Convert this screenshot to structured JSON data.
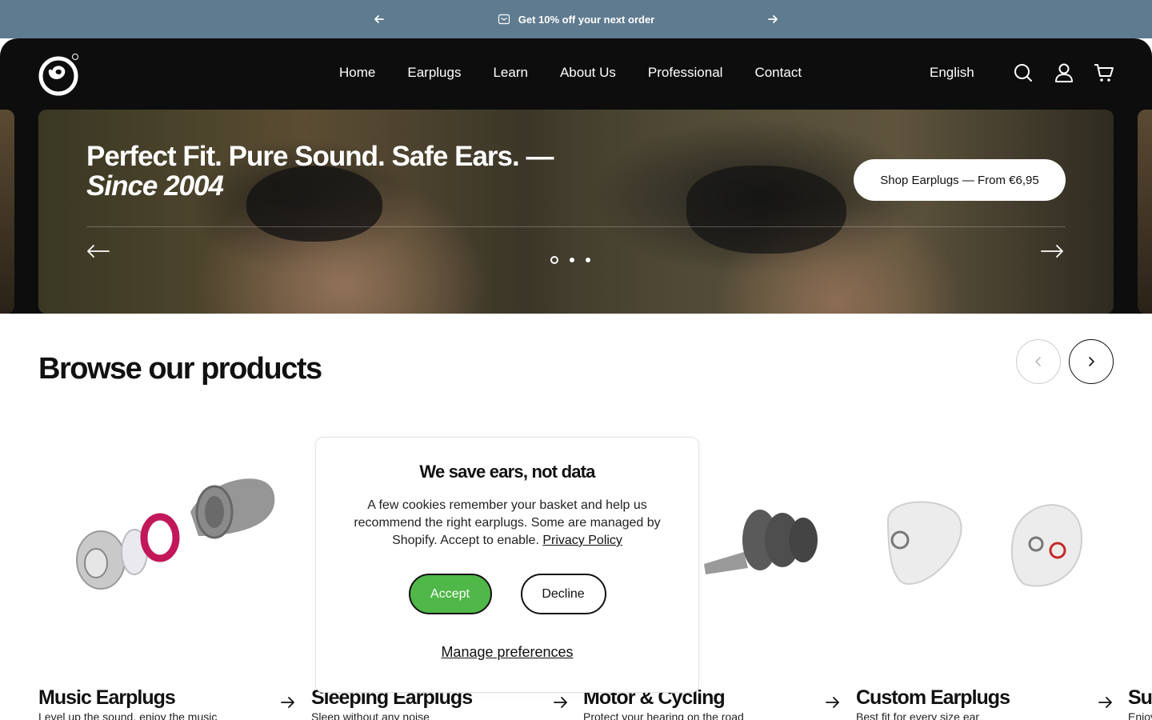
{
  "announcement": {
    "text": "Get 10% off your next order",
    "prev_icon": "arrow-left-icon",
    "next_icon": "arrow-right-icon",
    "background": "#5f7b90"
  },
  "header": {
    "nav": [
      "Home",
      "Earplugs",
      "Learn",
      "About Us",
      "Professional",
      "Contact"
    ],
    "language": "English",
    "icons": [
      "search-icon",
      "account-icon",
      "cart-icon"
    ]
  },
  "hero": {
    "title_line1": "Perfect Fit. Pure Sound. Safe Ears. —",
    "title_line2": "Since 2004",
    "cta": "Shop Earplugs — From €6,95",
    "slides_total": 3,
    "active_slide": 1
  },
  "browse": {
    "title": "Browse our products",
    "products": [
      {
        "name": "Music Earplugs",
        "subtitle": "Level up the sound, enjoy the music"
      },
      {
        "name": "Sleeping Earplugs",
        "subtitle": "Sleep without any noise"
      },
      {
        "name": "Motor & Cycling",
        "subtitle": "Protect your hearing on the road"
      },
      {
        "name": "Custom Earplugs",
        "subtitle": "Best fit for every size ear"
      },
      {
        "name": "Su",
        "subtitle": "Enjoy"
      }
    ]
  },
  "cookie": {
    "title": "We save ears, not data",
    "text": "A few cookies remember your basket and help us recommend the right earplugs. Some are managed by Shopify. Accept to enable.",
    "policy_link": "Privacy Policy",
    "accept": "Accept",
    "decline": "Decline",
    "manage": "Manage preferences",
    "accept_color": "#4fb848"
  }
}
